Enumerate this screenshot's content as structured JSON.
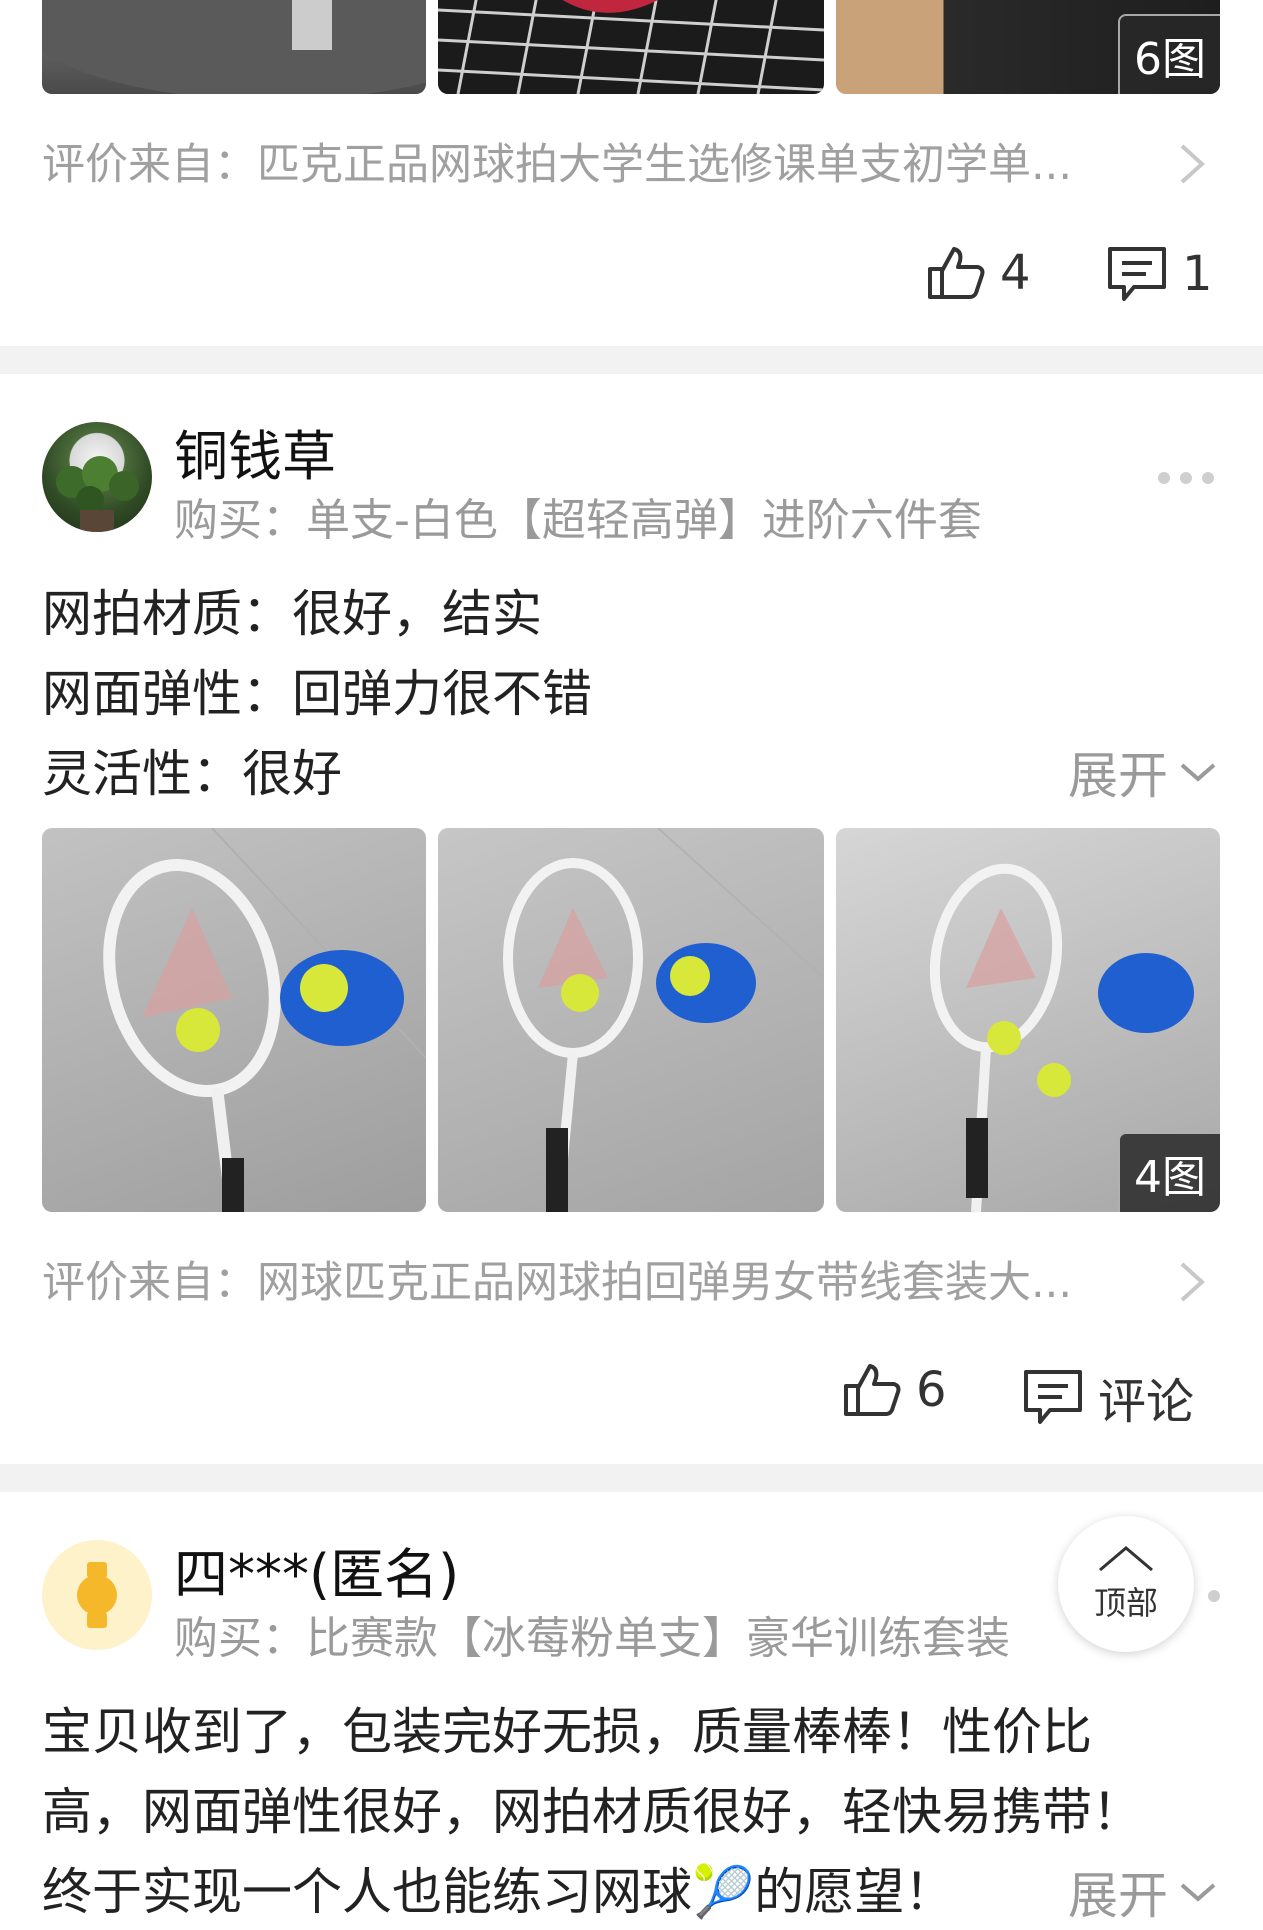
{
  "review1": {
    "image_badge": "6图",
    "source_label": "评价来自：",
    "source_product": "匹克正品网球拍大学生选修课单支初学单...",
    "likes": "4",
    "comments": "1"
  },
  "review2": {
    "username": "铜钱草",
    "purchase": "购买：单支-白色【超轻高弹】进阶六件套",
    "lines": [
      "网拍材质：很好，结实",
      "网面弹性：回弹力很不错",
      "灵活性：很好"
    ],
    "expand_label": "展开",
    "image_badge": "4图",
    "source_label": "评价来自：",
    "source_product": "网球匹克正品网球拍回弹男女带线套装大...",
    "likes": "6",
    "comment_label": "评论"
  },
  "review3": {
    "username": "四***(匿名)",
    "purchase": "购买：比赛款【冰莓粉单支】豪华训练套装",
    "lines": [
      "宝贝收到了，包装完好无损，质量棒棒！性价比",
      "高，网面弹性很好，网拍材质很好，轻快易携带！",
      "终于实现一个人也能练习网球🎾的愿望！"
    ],
    "expand_label": "展开"
  },
  "float": {
    "top_label": "顶部"
  },
  "colors": {
    "gap": "#f2f2f2",
    "muted": "#9a9a9a",
    "text": "#222222"
  }
}
